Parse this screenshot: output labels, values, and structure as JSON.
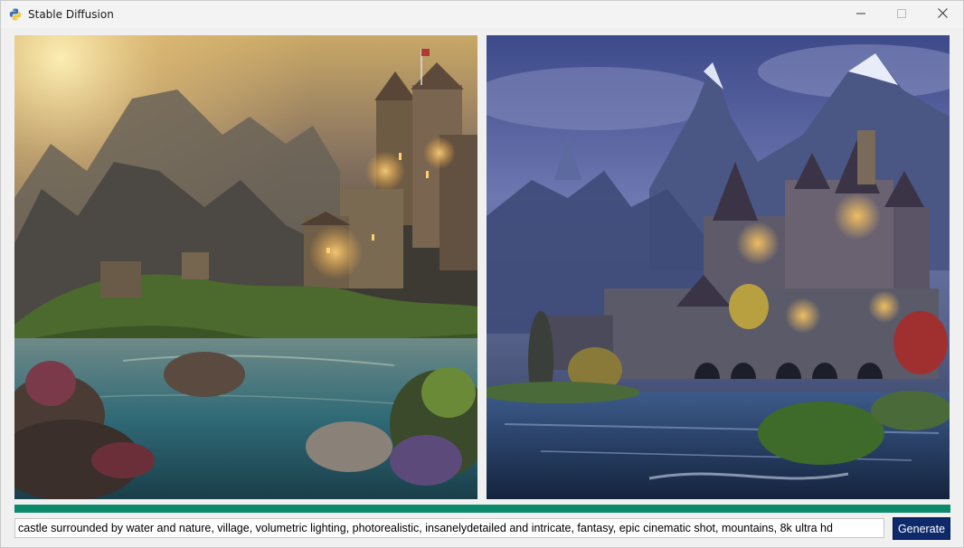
{
  "window": {
    "title": "Stable Diffusion",
    "icon": "python-icon",
    "controls": [
      "minimize-icon",
      "maximize-icon",
      "close-icon"
    ]
  },
  "images": [
    {
      "description_icon": "image-castle-sunset"
    },
    {
      "description_icon": "image-castle-blue-night"
    }
  ],
  "progress": {
    "value": 1.0,
    "color": "#0a8a6a"
  },
  "prompt": {
    "value": "castle surrounded by water and nature, village, volumetric lighting, photorealistic, insanelydetailed and intricate, fantasy, epic cinematic shot, mountains, 8k ultra hd"
  },
  "actions": {
    "generate_label": "Generate",
    "generate_color": "#0e2a6a"
  }
}
